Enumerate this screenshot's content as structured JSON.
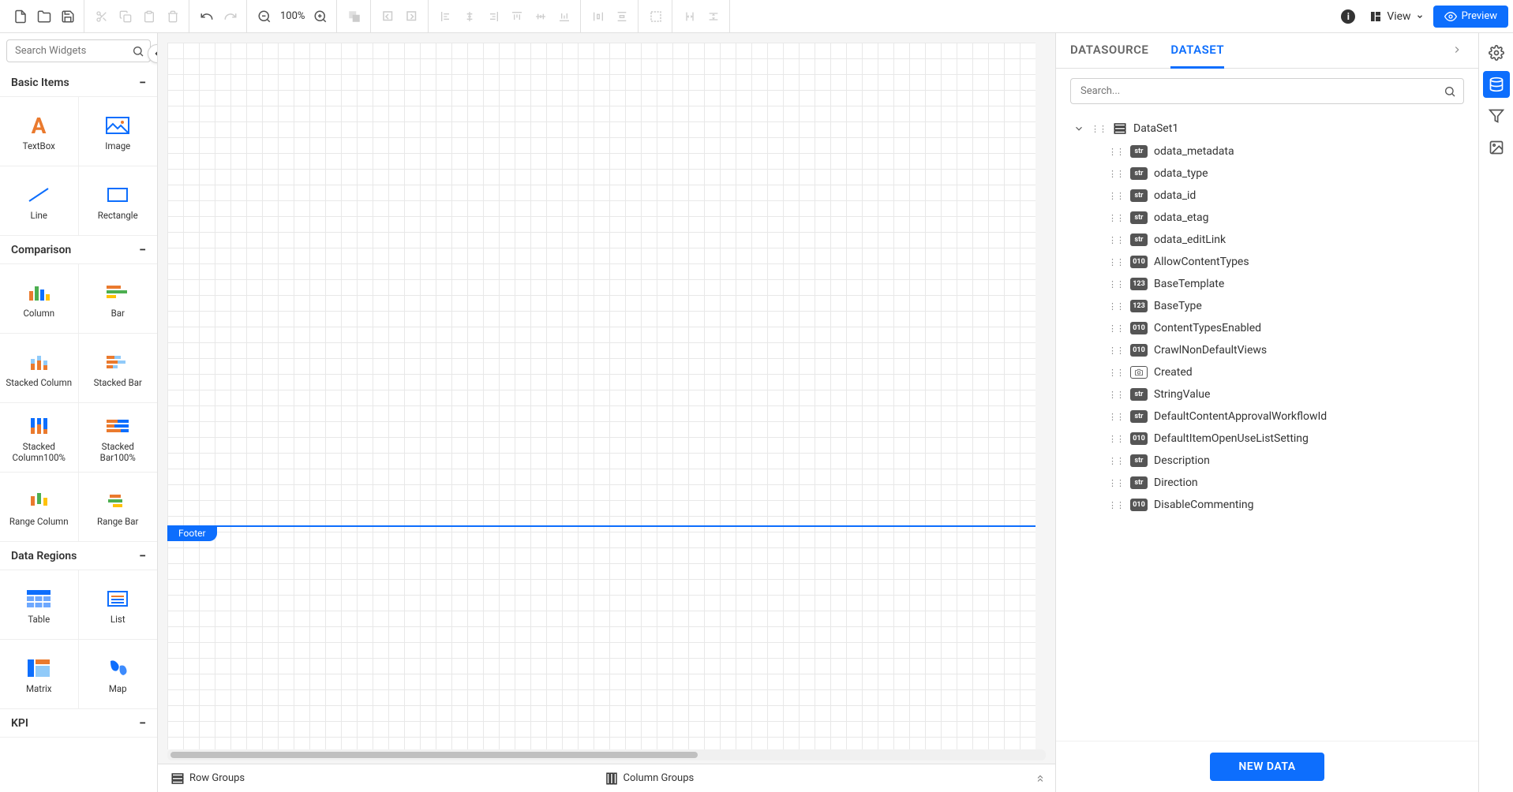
{
  "toolbar": {
    "zoom_label": "100%",
    "view_label": "View",
    "preview_label": "Preview"
  },
  "widget_search": {
    "placeholder": "Search Widgets"
  },
  "sections": {
    "basic": {
      "title": "Basic Items",
      "items": [
        "TextBox",
        "Image",
        "Line",
        "Rectangle"
      ]
    },
    "comparison": {
      "title": "Comparison",
      "items": [
        "Column",
        "Bar",
        "Stacked Column",
        "Stacked Bar",
        "Stacked Column100%",
        "Stacked Bar100%",
        "Range Column",
        "Range Bar"
      ]
    },
    "data_regions": {
      "title": "Data Regions",
      "items": [
        "Table",
        "List",
        "Matrix",
        "Map"
      ]
    },
    "kpi": {
      "title": "KPI"
    }
  },
  "canvas": {
    "footer_label": "Footer"
  },
  "groups_bar": {
    "row_groups": "Row Groups",
    "column_groups": "Column Groups"
  },
  "data_panel": {
    "tabs": {
      "datasource": "DATASOURCE",
      "dataset": "DATASET"
    },
    "search_placeholder": "Search...",
    "dataset_name": "DataSet1",
    "fields": [
      {
        "type": "str",
        "name": "odata_metadata"
      },
      {
        "type": "str",
        "name": "odata_type"
      },
      {
        "type": "str",
        "name": "odata_id"
      },
      {
        "type": "str",
        "name": "odata_etag"
      },
      {
        "type": "str",
        "name": "odata_editLink"
      },
      {
        "type": "010",
        "name": "AllowContentTypes"
      },
      {
        "type": "123",
        "name": "BaseTemplate"
      },
      {
        "type": "123",
        "name": "BaseType"
      },
      {
        "type": "010",
        "name": "ContentTypesEnabled"
      },
      {
        "type": "010",
        "name": "CrawlNonDefaultViews"
      },
      {
        "type": "cam",
        "name": "Created"
      },
      {
        "type": "str",
        "name": "StringValue"
      },
      {
        "type": "str",
        "name": "DefaultContentApprovalWorkflowId"
      },
      {
        "type": "010",
        "name": "DefaultItemOpenUseListSetting"
      },
      {
        "type": "str",
        "name": "Description"
      },
      {
        "type": "str",
        "name": "Direction"
      },
      {
        "type": "010",
        "name": "DisableCommenting"
      }
    ],
    "new_data_label": "NEW DATA"
  }
}
